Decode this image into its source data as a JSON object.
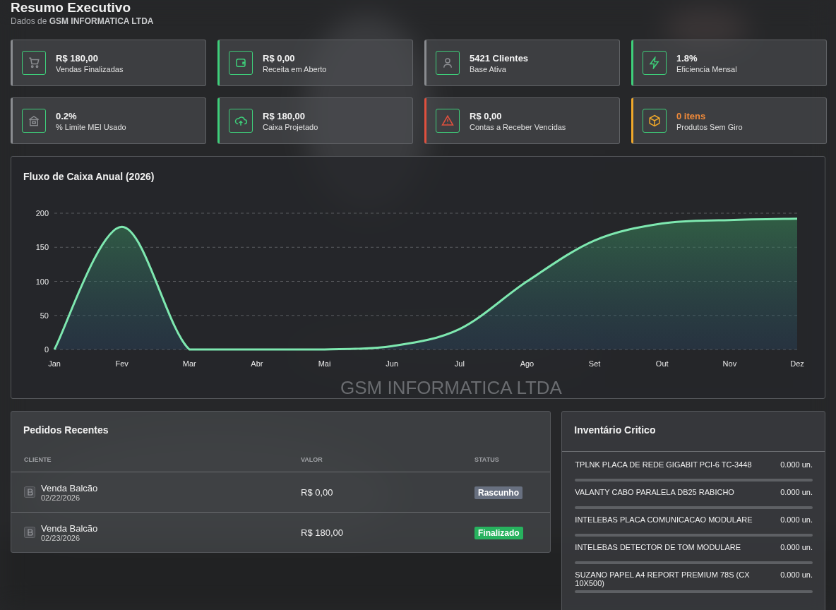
{
  "header": {
    "title": "Resumo Executivo",
    "subtitle": "Dados de **GSM INFORMATICA LTDA**"
  },
  "kpis": [
    {
      "value": "R$ 180,00",
      "label": "Vendas Finalizadas",
      "kind": "cart",
      "color": "#8a8c90",
      "value_alert": false
    },
    {
      "value": "R$ 0,00",
      "label": "Receita em Aberto",
      "kind": "wallet",
      "color": "#3ecf7a",
      "value_alert": false
    },
    {
      "value": "5421 Clientes",
      "label": "Base Ativa",
      "kind": "user",
      "color": "#8a8c90",
      "value_alert": false
    },
    {
      "value": "1.8%",
      "label": "Eficiencia Mensal",
      "kind": "bolt",
      "color": "#3ecf7a",
      "value_alert": false
    },
    {
      "value": "0.2%",
      "label": "% Limite MEI Usado",
      "kind": "building",
      "color": "#8a8c90",
      "value_alert": false
    },
    {
      "value": "R$ 180,00",
      "label": "Caixa Projetado",
      "kind": "cloud",
      "color": "#3ecf7a",
      "value_alert": false
    },
    {
      "value": "R$ 0,00",
      "label": "Contas a Receber Vencidas",
      "kind": "warning",
      "color": "#e0503e",
      "value_alert": false
    },
    {
      "value": "0 itens",
      "label": "Produtos Sem Giro",
      "kind": "box",
      "color": "#f0a82a",
      "value_alert": true
    }
  ],
  "cashflow": {
    "title": "Fluxo de Caixa Anual (2026)",
    "watermark": "GSM INFORMATICA LTDA",
    "chart_data": {
      "type": "area",
      "grid": true,
      "categories": [
        "Jan",
        "Fev",
        "Mar",
        "Abr",
        "Mai",
        "Jun",
        "Jul",
        "Ago",
        "Set",
        "Out",
        "Nov",
        "Dez"
      ],
      "series": [
        {
          "color": "#7ee8b0",
          "values": [
            0,
            180,
            0,
            0,
            0,
            5,
            30,
            100,
            160,
            185,
            190,
            192
          ]
        }
      ],
      "ylim": [
        0,
        200
      ],
      "yticks": [
        0,
        50,
        100,
        150,
        200
      ]
    }
  },
  "orders": {
    "title": "Pedidos Recentes",
    "columns": [
      "CLIENTE",
      "VALOR",
      "STATUS"
    ],
    "rows": [
      {
        "client": "Venda Balcão",
        "date": "02/22/2026",
        "value": "R$ 0,00",
        "status": "Rascunho",
        "kind": "draft"
      },
      {
        "client": "Venda Balcão",
        "date": "02/23/2026",
        "value": "R$ 180,00",
        "status": "Finalizado",
        "kind": "done"
      }
    ]
  },
  "inventory": {
    "title": "Inventário Critico",
    "items": [
      {
        "name": "TPLNK PLACA DE REDE GIGABIT PCI-6 TC-3448",
        "qty": "0.000 un.",
        "level": 0
      },
      {
        "name": "VALANTY CABO PARALELA DB25 RABICHO",
        "qty": "0.000 un.",
        "level": 0
      },
      {
        "name": "INTELEBAS PLACA COMUNICACAO MODULARE",
        "qty": "0.000 un.",
        "level": 0
      },
      {
        "name": "INTELEBAS DETECTOR DE TOM MODULARE",
        "qty": "0.000 un.",
        "level": 0
      },
      {
        "name": "SUZANO PAPEL A4 REPORT PREMIUM 78S (CX 10X500)",
        "qty": "0.000 un.",
        "level": 0
      }
    ]
  }
}
